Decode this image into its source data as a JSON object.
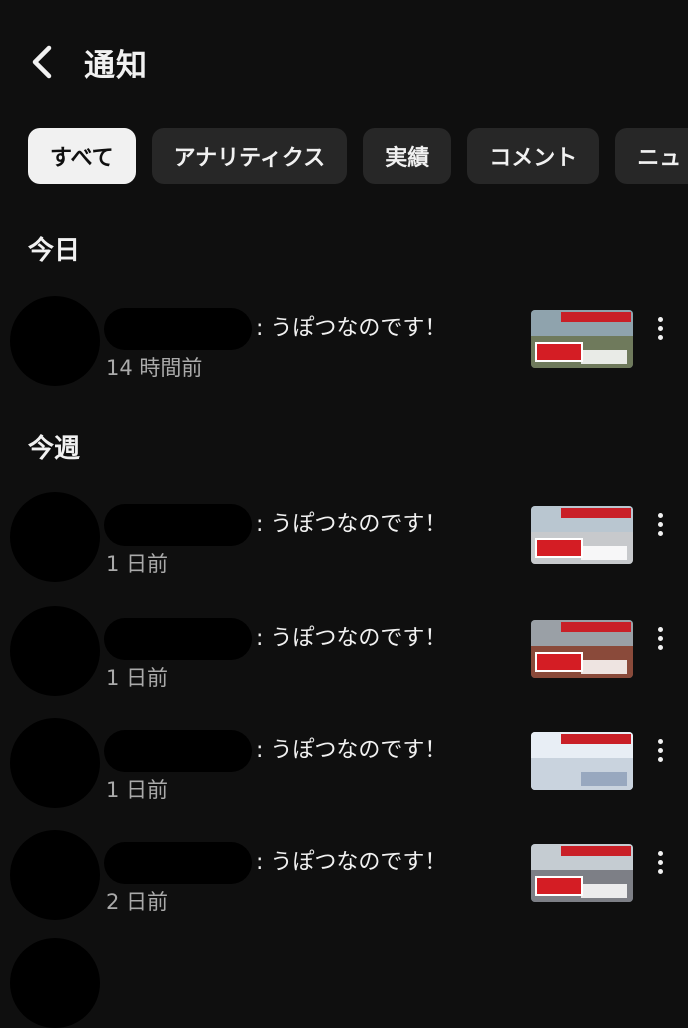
{
  "header": {
    "title": "通知",
    "back_icon": "chevron-left-icon"
  },
  "filters": [
    {
      "label": "すべて",
      "active": true
    },
    {
      "label": "アナリティクス",
      "active": false
    },
    {
      "label": "実績",
      "active": false
    },
    {
      "label": "コメント",
      "active": false
    },
    {
      "label": "ニュ",
      "active": false
    }
  ],
  "sections": {
    "today": {
      "title": "今日"
    },
    "this_week": {
      "title": "今週"
    }
  },
  "notifications": [
    {
      "message": ": うぽつなのです！",
      "time": "14 時間前"
    },
    {
      "message": ": うぽつなのです！",
      "time": "1 日前"
    },
    {
      "message": ": うぽつなのです！",
      "time": "1 日前"
    },
    {
      "message": ": うぽつなのです！",
      "time": "1 日前"
    },
    {
      "message": ": うぽつなのです！",
      "time": "2 日前"
    }
  ],
  "colors": {
    "background": "#0f0f0f",
    "chip_bg": "#272727",
    "chip_active_bg": "#f1f1f1",
    "secondary_text": "#aaaaaa",
    "thumb_red": "#d41d24"
  }
}
